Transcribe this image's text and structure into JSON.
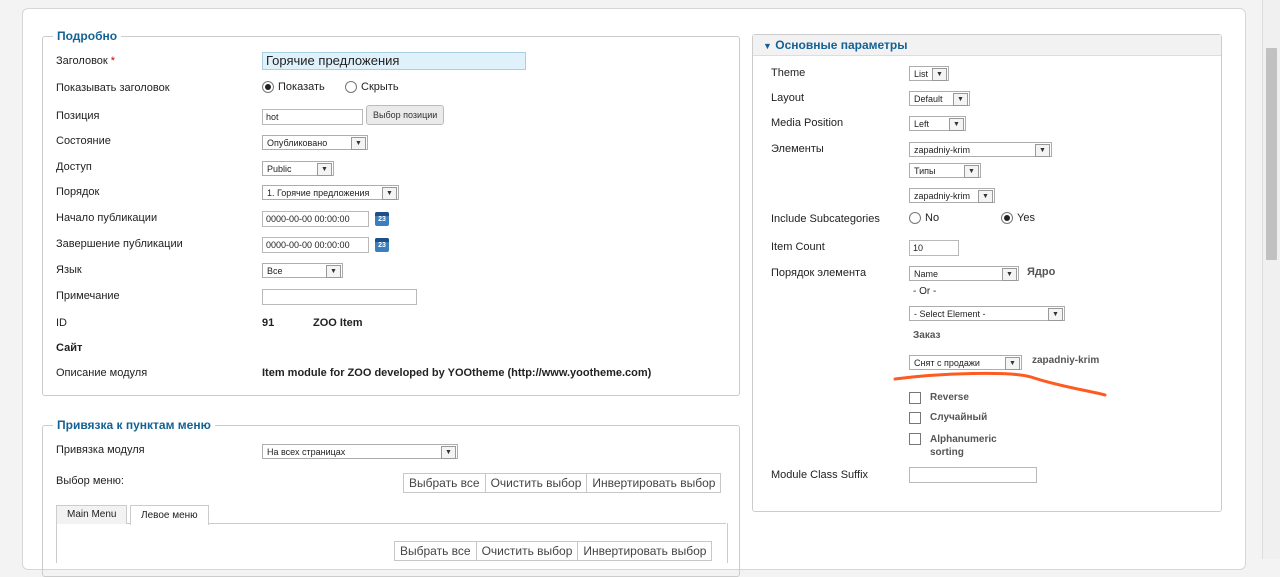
{
  "details": {
    "legend": "Подробно",
    "title_label": "Заголовок",
    "title_required_mark": "*",
    "title_value": "Горячие предложения",
    "show_title_label": "Показывать заголовок",
    "show_option": "Показать",
    "hide_option": "Скрыть",
    "position_label": "Позиция",
    "position_value": "hot",
    "position_button": "Выбор позиции",
    "state_label": "Состояние",
    "state_value": "Опубликовано",
    "access_label": "Доступ",
    "access_value": "Public",
    "order_label": "Порядок",
    "order_value": "1. Горячие предложения",
    "publish_up_label": "Начало публикации",
    "publish_up_value": "0000-00-00 00:00:00",
    "publish_down_label": "Завершение публикации",
    "publish_down_value": "0000-00-00 00:00:00",
    "calendar_day": "23",
    "language_label": "Язык",
    "language_value": "Все",
    "note_label": "Примечание",
    "note_value": "",
    "id_label": "ID",
    "id_value": "91",
    "id_type": "ZOO Item",
    "site_label": "Сайт",
    "description_label": "Описание модуля",
    "description_value": "Item module for ZOO developed by YOOtheme (http://www.yootheme.com)"
  },
  "menu_binding": {
    "legend": "Привязка к пунктам меню",
    "binding_label": "Привязка модуля",
    "binding_value": "На всех страницах",
    "menu_select_label": "Выбор меню:",
    "select_all": "Выбрать все",
    "clear_selection": "Очистить выбор",
    "invert_selection": "Инвертировать выбор",
    "tabs": [
      "Main Menu",
      "Левое меню"
    ],
    "active_tab": 1
  },
  "basic_params": {
    "legend": "Основные параметры",
    "legend_icon": "triangle-down-icon",
    "theme_label": "Theme",
    "theme_value": "List",
    "layout_label": "Layout",
    "layout_value": "Default",
    "media_label": "Media Position",
    "media_value": "Left",
    "elements_label": "Элементы",
    "elements_app": "zapadniy-krim",
    "elements_types": "Типы",
    "elements_category": "zapadniy-krim",
    "include_sub_label": "Include Subcategories",
    "include_no": "No",
    "include_yes": "Yes",
    "item_count_label": "Item Count",
    "item_count_value": "10",
    "order_label": "Порядок элемента",
    "order_value": "Name",
    "order_core": "Ядро",
    "or_text": "- Or -",
    "select_element": "- Select Element -",
    "order_caption": "Заказ",
    "sort_value": "Снят с продажи",
    "sort_app": "zapadniy-krim",
    "reverse_label": "Reverse",
    "random_label": "Случайный",
    "alpha_label": "Alphanumeric sorting",
    "suffix_label": "Module Class Suffix",
    "suffix_value": ""
  },
  "colors": {
    "legend": "#146295",
    "annotation": "#ff5a1f",
    "title_bg": "#dff1fa"
  }
}
